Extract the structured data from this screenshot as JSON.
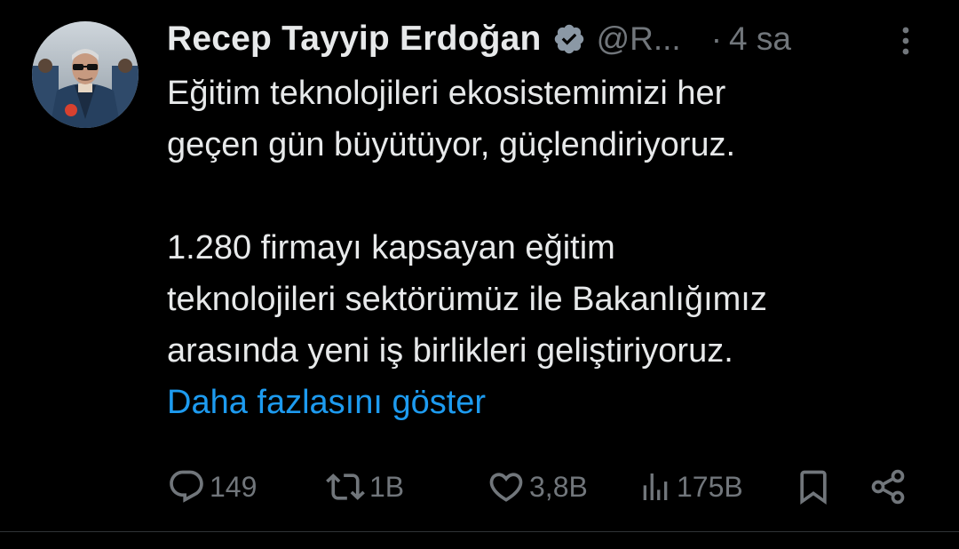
{
  "tweet": {
    "author": {
      "name": "Recep Tayyip Erdoğan",
      "handle": "@R...",
      "verified": true,
      "avatar_icon": "profile-photo"
    },
    "separator": "·",
    "time": "4 sa",
    "menu_icon": "more-vertical-icon",
    "text": {
      "line1": "Eğitim teknolojileri ekosistemimizi her",
      "line2": "geçen gün büyütüyor, güçlendiriyoruz.",
      "line3": "1.280 firmayı kapsayan eğitim",
      "line4": "teknolojileri sektörümüz ile Bakanlığımız",
      "line5": "arasında yeni iş birlikleri geliştiriyoruz."
    },
    "show_more": "Daha fazlasını göster",
    "actions": {
      "reply": {
        "icon": "reply-icon",
        "count": "149"
      },
      "repost": {
        "icon": "repost-icon",
        "count": "1B"
      },
      "like": {
        "icon": "heart-icon",
        "count": "3,8B"
      },
      "views": {
        "icon": "views-icon",
        "count": "175B"
      },
      "bookmark": {
        "icon": "bookmark-icon"
      },
      "share": {
        "icon": "share-icon"
      }
    }
  },
  "colors": {
    "background": "#000000",
    "text": "#e7e9ea",
    "secondary": "#71767b",
    "link": "#1d9bf0",
    "verified_badge": "#8b98a5"
  }
}
